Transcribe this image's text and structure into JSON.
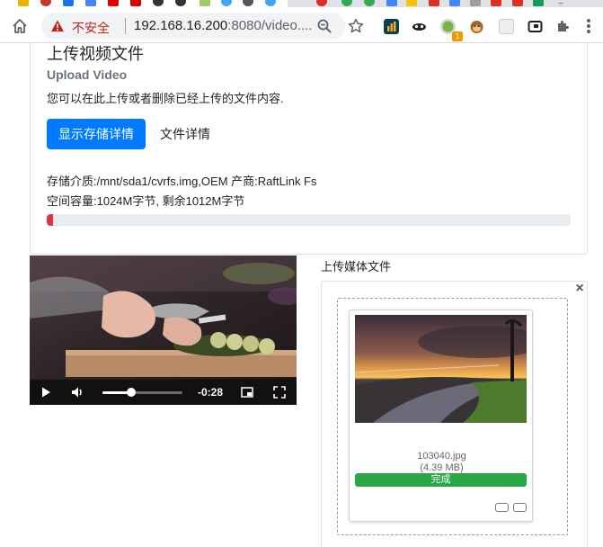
{
  "browser": {
    "security_label": "不安全",
    "url_host": "192.168.16.200",
    "url_rest": ":8080/video....",
    "extension_badge": "1"
  },
  "card": {
    "title": "上传视频文件",
    "subtitle": "Upload Video",
    "description": "您可以在此上传或者删除已经上传的文件内容.",
    "show_storage_button": "显示存储详情",
    "file_details_button": "文件详情",
    "storage_medium": "存储介质:/mnt/sda1/cvrfs.img,OEM 产商:RaftLink Fs",
    "capacity": "空间容量:1024M字节, 剩余1012M字节",
    "used_fraction": 0.0117
  },
  "video": {
    "time_remaining": "-0:28",
    "played_fraction": 0.36
  },
  "upload": {
    "label": "上传媒体文件",
    "close_symbol": "×",
    "file": {
      "name": "103040.jpg",
      "size": "(4.39 MB)",
      "status": "完成",
      "progress_fraction": 1.0
    }
  },
  "colors": {
    "primary": "#007bff",
    "danger": "#dc3545",
    "success": "#28a745",
    "insecure": "#c5221f"
  }
}
